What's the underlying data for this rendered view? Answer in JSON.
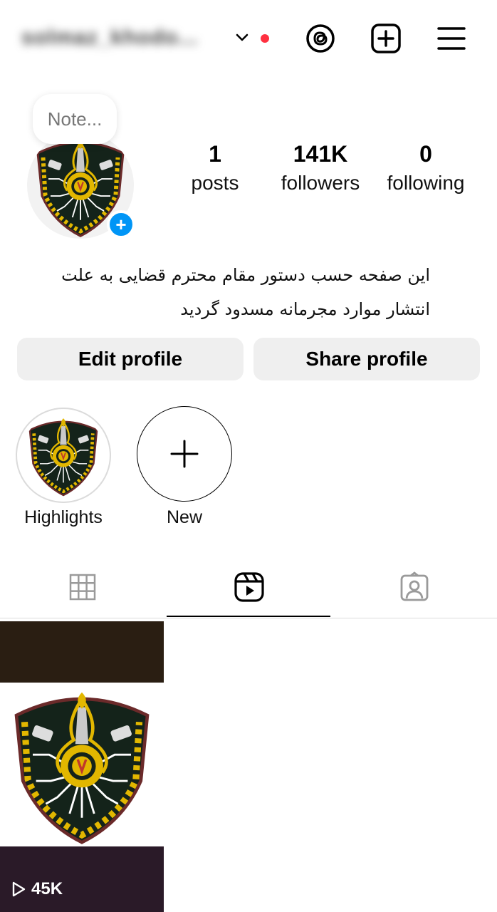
{
  "header": {
    "username": "solmaz_khodo...",
    "icons": [
      "chevron-down-icon",
      "notification-dot",
      "threads-icon",
      "create-post-icon",
      "menu-icon"
    ],
    "notification_color": "#ff3040"
  },
  "profile": {
    "note_placeholder": "Note...",
    "add_story_symbol": "+",
    "stats": [
      {
        "value": "1",
        "label": "posts"
      },
      {
        "value": "141K",
        "label": "followers"
      },
      {
        "value": "0",
        "label": "following"
      }
    ],
    "bio_lines": [
      "این صفحه حسب دستور مقام محترم قضایی به علت",
      "انتشار موارد مجرمانه مسدود گردید"
    ]
  },
  "actions": {
    "edit_label": "Edit profile",
    "share_label": "Share profile"
  },
  "highlights": [
    {
      "label": "Highlights"
    },
    {
      "label": "New",
      "symbol": "+"
    }
  ],
  "tabs": [
    {
      "name": "grid",
      "icon": "grid-icon"
    },
    {
      "name": "reels",
      "icon": "reels-icon",
      "active": true
    },
    {
      "name": "tagged",
      "icon": "tagged-icon"
    }
  ],
  "posts": [
    {
      "views": "45K",
      "icon": "play-icon"
    }
  ],
  "colors": {
    "accent_blue": "#0095f6",
    "button_bg": "#efefef"
  }
}
